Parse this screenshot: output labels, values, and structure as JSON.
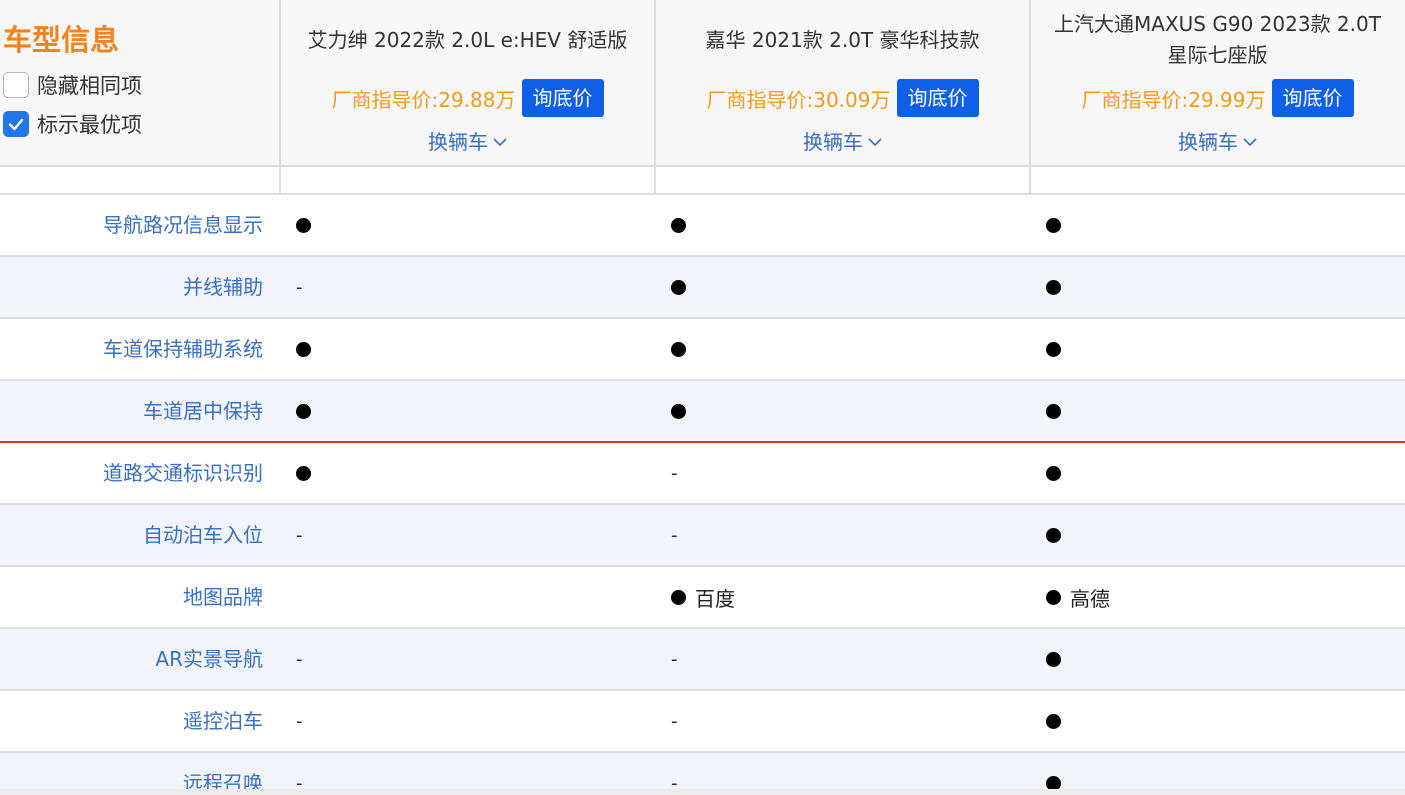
{
  "header": {
    "section_title": "车型信息",
    "options": [
      {
        "label": "隐藏相同项",
        "checked": false
      },
      {
        "label": "标示最优项",
        "checked": true
      }
    ],
    "cars": [
      {
        "name": "艾力绅 2022款 2.0L e:HEV 舒适版",
        "price_label": "厂商指导价:",
        "price_value": "29.88万",
        "ask_label": "询底价",
        "switch_label": "换辆车"
      },
      {
        "name": "嘉华 2021款 2.0T 豪华科技款",
        "price_label": "厂商指导价:",
        "price_value": "30.09万",
        "ask_label": "询底价",
        "switch_label": "换辆车"
      },
      {
        "name": "上汽大通MAXUS G90 2023款 2.0T 星际七座版",
        "price_label": "厂商指导价:",
        "price_value": "29.99万",
        "ask_label": "询底价",
        "switch_label": "换辆车"
      }
    ]
  },
  "rows": [
    {
      "label": "导航路况信息显示",
      "cells": [
        {
          "dot": true,
          "text": ""
        },
        {
          "dot": true,
          "text": ""
        },
        {
          "dot": true,
          "text": ""
        }
      ]
    },
    {
      "label": "并线辅助",
      "cells": [
        {
          "dot": false,
          "text": "-"
        },
        {
          "dot": true,
          "text": ""
        },
        {
          "dot": true,
          "text": ""
        }
      ]
    },
    {
      "label": "车道保持辅助系统",
      "cells": [
        {
          "dot": true,
          "text": ""
        },
        {
          "dot": true,
          "text": ""
        },
        {
          "dot": true,
          "text": ""
        }
      ]
    },
    {
      "label": "车道居中保持",
      "cells": [
        {
          "dot": true,
          "text": ""
        },
        {
          "dot": true,
          "text": ""
        },
        {
          "dot": true,
          "text": ""
        }
      ]
    },
    {
      "label": "道路交通标识识别",
      "cells": [
        {
          "dot": true,
          "text": ""
        },
        {
          "dot": false,
          "text": "-"
        },
        {
          "dot": true,
          "text": ""
        }
      ]
    },
    {
      "label": "自动泊车入位",
      "cells": [
        {
          "dot": false,
          "text": "-"
        },
        {
          "dot": false,
          "text": "-"
        },
        {
          "dot": true,
          "text": ""
        }
      ]
    },
    {
      "label": "地图品牌",
      "cells": [
        {
          "dot": false,
          "text": ""
        },
        {
          "dot": true,
          "text": "百度"
        },
        {
          "dot": true,
          "text": "高德"
        }
      ]
    },
    {
      "label": "AR实景导航",
      "cells": [
        {
          "dot": false,
          "text": "-"
        },
        {
          "dot": false,
          "text": "-"
        },
        {
          "dot": true,
          "text": ""
        }
      ]
    },
    {
      "label": "遥控泊车",
      "cells": [
        {
          "dot": false,
          "text": "-"
        },
        {
          "dot": false,
          "text": "-"
        },
        {
          "dot": true,
          "text": ""
        }
      ]
    },
    {
      "label": "远程召唤",
      "cells": [
        {
          "dot": false,
          "text": "-"
        },
        {
          "dot": false,
          "text": "-"
        },
        {
          "dot": true,
          "text": ""
        }
      ]
    }
  ],
  "colors": {
    "accent_orange": "#f7821b",
    "price_orange": "#f59a1a",
    "button_blue": "#0f5fe8",
    "label_blue": "#3a6fc4",
    "highlight_red": "#e0312d"
  }
}
